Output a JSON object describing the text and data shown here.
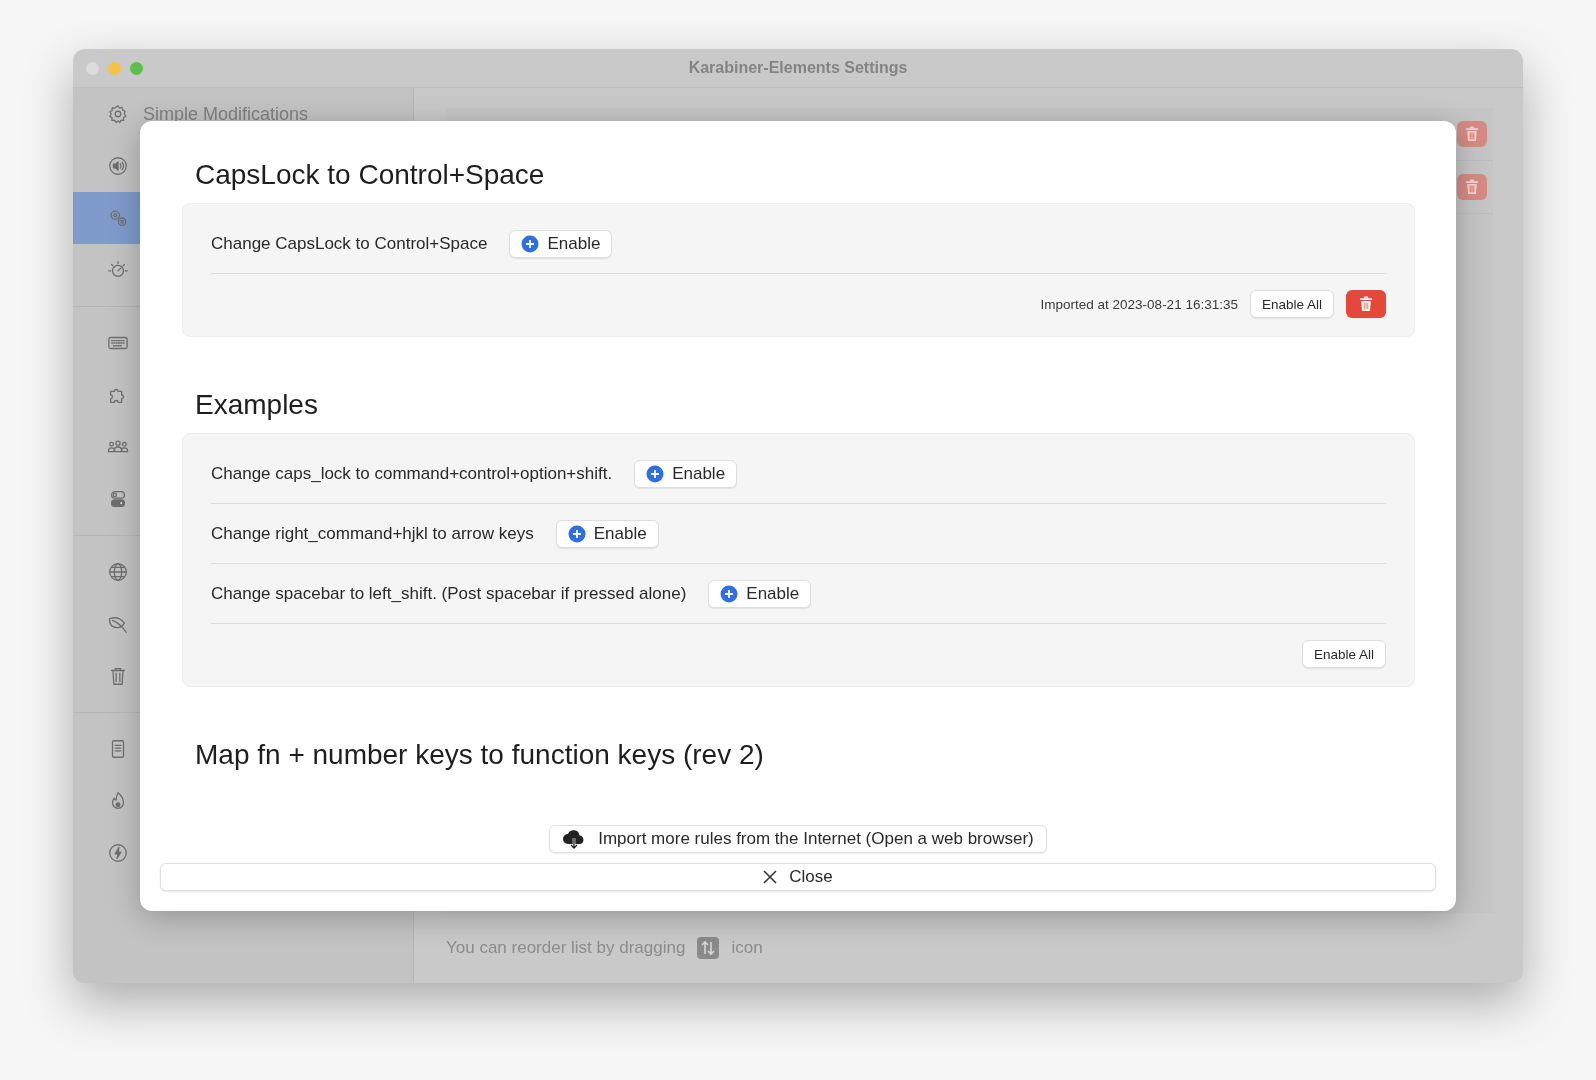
{
  "window": {
    "title": "Karabiner-Elements Settings"
  },
  "sidebar": {
    "groups": [
      {
        "items": [
          {
            "label": "Simple Modifications",
            "selected": false
          },
          {
            "selected": false
          },
          {
            "selected": true
          },
          {
            "selected": false
          }
        ]
      },
      {
        "items": [
          {
            "selected": false
          },
          {
            "selected": false
          },
          {
            "selected": false
          },
          {
            "selected": false
          }
        ]
      },
      {
        "items": [
          {
            "selected": false
          },
          {
            "selected": false
          },
          {
            "selected": false
          }
        ]
      },
      {
        "items": [
          {
            "selected": false
          },
          {
            "selected": false
          },
          {
            "selected": false
          }
        ]
      }
    ]
  },
  "main": {
    "hint": {
      "before": "You can reorder list by dragging",
      "after": "icon"
    }
  },
  "sheet": {
    "sections": [
      {
        "title": "CapsLock to Control+Space",
        "rules": [
          {
            "description": "Change CapsLock to Control+Space",
            "button": "Enable"
          }
        ],
        "imported": "Imported at 2023-08-21 16:31:35",
        "enable_all": "Enable All",
        "deletable": true
      },
      {
        "title": "Examples",
        "rules": [
          {
            "description": "Change caps_lock to command+control+option+shift.",
            "button": "Enable"
          },
          {
            "description": "Change right_command+hjkl to arrow keys",
            "button": "Enable"
          },
          {
            "description": "Change spacebar to left_shift. (Post spacebar if pressed alone)",
            "button": "Enable"
          }
        ],
        "enable_all": "Enable All",
        "deletable": false
      },
      {
        "title": "Map fn + number keys to function keys (rev 2)"
      }
    ],
    "import_button": "Import more rules from the Internet (Open a web browser)",
    "close_button": "Close"
  }
}
